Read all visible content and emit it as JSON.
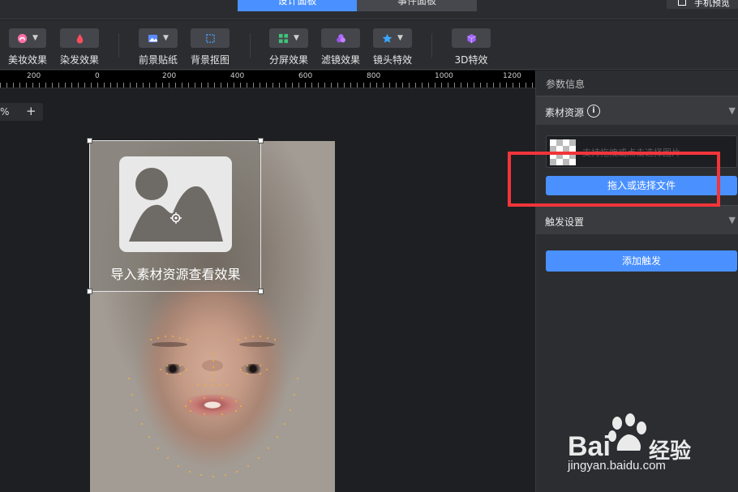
{
  "topbar": {
    "tabs": [
      {
        "label": "设计面板",
        "active": true
      },
      {
        "label": "事件面板",
        "active": false
      }
    ],
    "preview_label": "手机预览"
  },
  "toolbar": {
    "tools": [
      {
        "label": "美妆效果",
        "icon": "makeup-icon",
        "dropdown": true
      },
      {
        "label": "染发效果",
        "icon": "hair-dye-icon",
        "dropdown": false
      },
      {
        "label": "前景贴纸",
        "icon": "sticker-icon",
        "dropdown": true
      },
      {
        "label": "背景抠图",
        "icon": "background-cutout-icon",
        "dropdown": false
      },
      {
        "label": "分屏效果",
        "icon": "split-screen-icon",
        "dropdown": true
      },
      {
        "label": "滤镜效果",
        "icon": "filter-icon",
        "dropdown": false
      },
      {
        "label": "镜头特效",
        "icon": "lens-effect-icon",
        "dropdown": true
      },
      {
        "label": "3D特效",
        "icon": "cube-3d-icon",
        "dropdown": false
      }
    ]
  },
  "ruler": {
    "labels": [
      "200",
      "0",
      "200",
      "400",
      "600",
      "800",
      "1000",
      "1200"
    ]
  },
  "canvas": {
    "zoom_label": "%",
    "zoom_plus": "+",
    "placeholder_text": "导入素材资源查看效果"
  },
  "panel": {
    "title": "参数信息",
    "material_section": {
      "title": "素材资源",
      "info": "i"
    },
    "file_placeholder": "支持拖拽或点击选择图片",
    "upload_button": "拖入或选择文件",
    "trigger_section": {
      "title": "触发设置"
    },
    "add_trigger_button": "添加触发"
  },
  "watermark": {
    "brand": "Bai",
    "brand2": "经验",
    "url": "jingyan.baidu.com"
  },
  "colors": {
    "accent": "#4a90ff",
    "highlight": "#f2353a"
  }
}
